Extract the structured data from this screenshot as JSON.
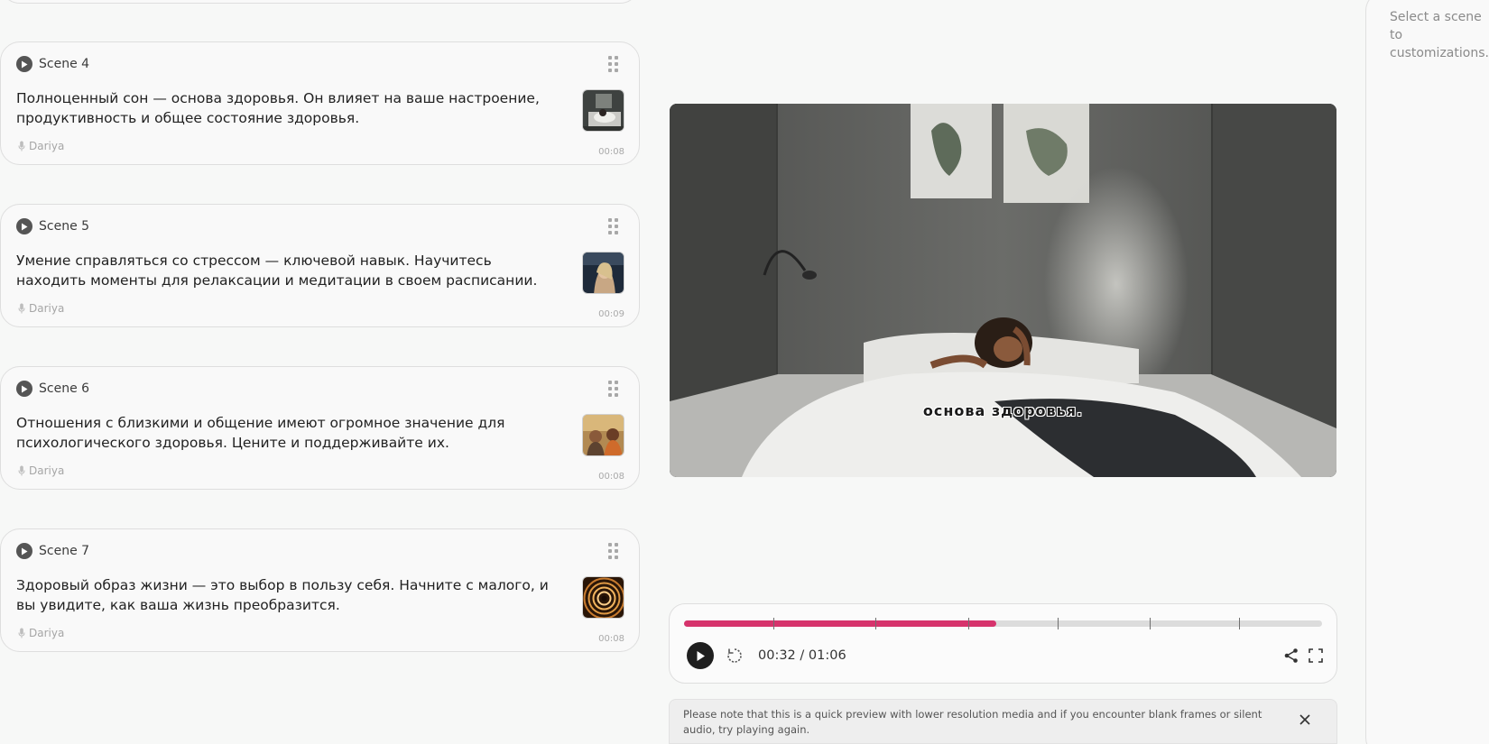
{
  "scenes": [
    {
      "title": "Scene 4",
      "text": "Полноценный сон — основа здоровья. Он влияет на ваше настроение, продуктивность и общее состояние здоровья.",
      "voice": "Dariya",
      "duration": "00:08",
      "thumbnail_icon": "bedroom-thumbnail"
    },
    {
      "title": "Scene 5",
      "text": "Умение справляться со стрессом — ключевой навык. Научитесь находить моменты для релаксации и медитации в своем расписании.",
      "voice": "Dariya",
      "duration": "00:09",
      "thumbnail_icon": "woman-in-car-thumbnail"
    },
    {
      "title": "Scene 6",
      "text": "Отношения с близкими и общение имеют огромное значение для психологического здоровья. Цените и поддерживайте их.",
      "voice": "Dariya",
      "duration": "00:08",
      "thumbnail_icon": "friends-thumbnail"
    },
    {
      "title": "Scene 7",
      "text": "Здоровый образ жизни — это выбор в пользу себя. Начните с малого, и вы увидите, как ваша жизнь преобразится.",
      "voice": "Dariya",
      "duration": "00:08",
      "thumbnail_icon": "abstract-rings-thumbnail"
    }
  ],
  "preview": {
    "subtitle": "основа здоровья.",
    "image_icon": "woman-in-bed-video-frame"
  },
  "player": {
    "time": "00:32 / 01:06",
    "progress_fraction": 0.49,
    "scene_markers_fraction": [
      0.14,
      0.3,
      0.445,
      0.585,
      0.73,
      0.87
    ],
    "progress_color": "#d6336c"
  },
  "notice": {
    "text": "Please note that this is a quick preview with lower resolution media and if you encounter blank frames or silent audio, try playing again."
  },
  "right_panel": {
    "hint": "Select a scene to customizations."
  }
}
